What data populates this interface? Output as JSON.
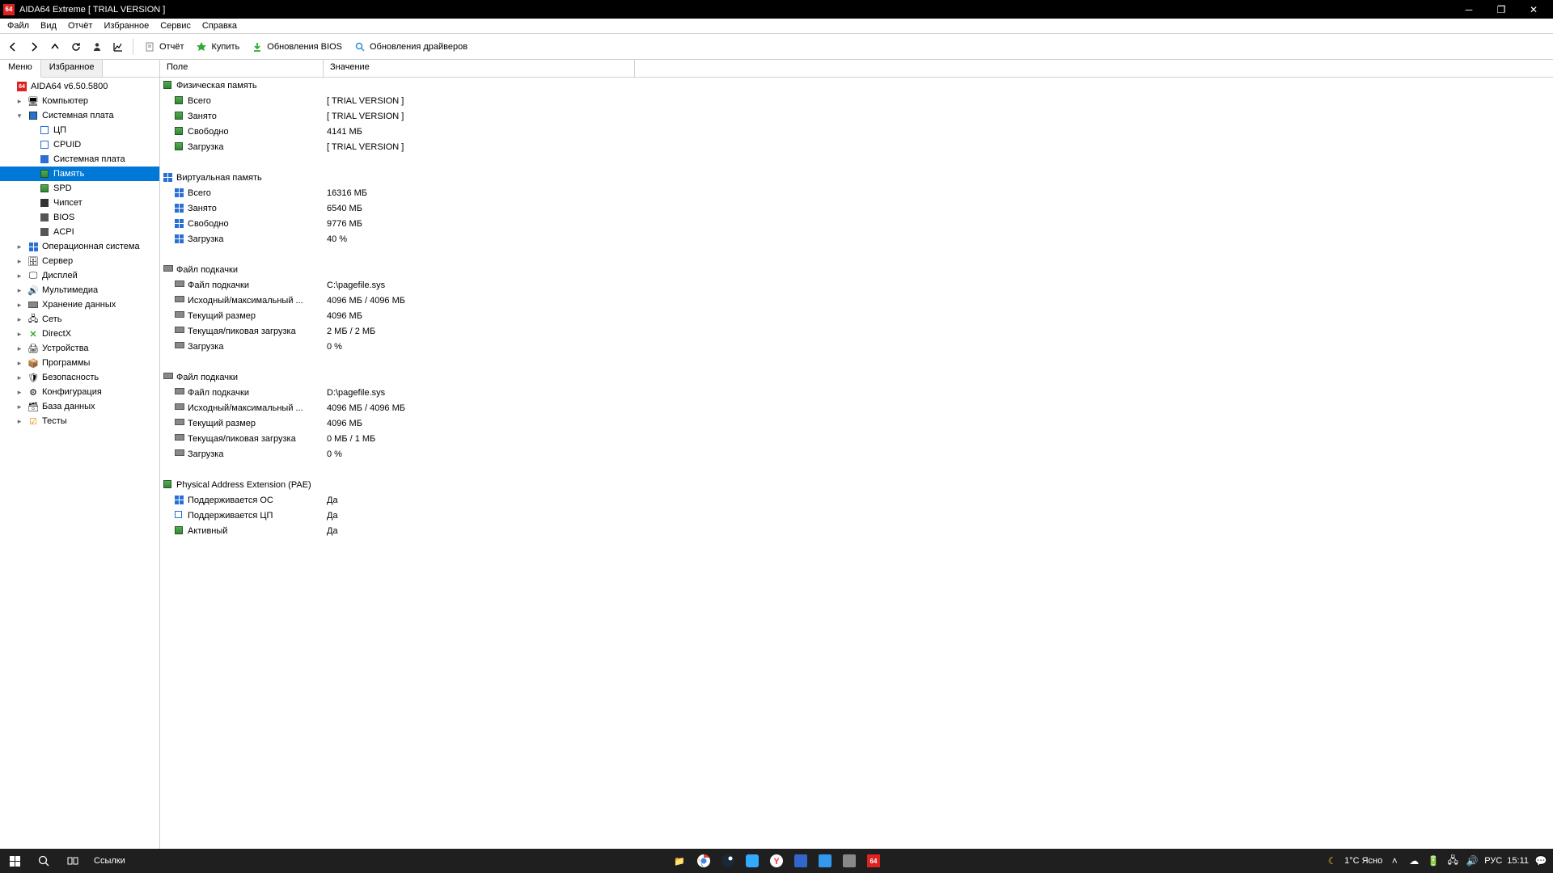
{
  "title": "AIDA64 Extreme  [ TRIAL VERSION ]",
  "menu": [
    "Файл",
    "Вид",
    "Отчёт",
    "Избранное",
    "Сервис",
    "Справка"
  ],
  "toolbar": {
    "report": "Отчёт",
    "buy": "Купить",
    "bios": "Обновления BIOS",
    "drivers": "Обновления драйверов"
  },
  "tabs": {
    "menu": "Меню",
    "fav": "Избранное"
  },
  "tree": {
    "root": "AIDA64 v6.50.5800",
    "computer": "Компьютер",
    "motherboard": "Системная плата",
    "mb_children": [
      "ЦП",
      "CPUID",
      "Системная плата",
      "Память",
      "SPD",
      "Чипсет",
      "BIOS",
      "ACPI"
    ],
    "os": "Операционная система",
    "server": "Сервер",
    "display": "Дисплей",
    "multimedia": "Мультимедиа",
    "storage": "Хранение данных",
    "network": "Сеть",
    "directx": "DirectX",
    "devices": "Устройства",
    "programs": "Программы",
    "security": "Безопасность",
    "config": "Конфигурация",
    "database": "База данных",
    "tests": "Тесты"
  },
  "columns": {
    "field": "Поле",
    "value": "Значение"
  },
  "groups": [
    {
      "title": "Физическая память",
      "icon": "chip-green",
      "rows": [
        {
          "icon": "chip-green",
          "f": "Всего",
          "v": "[ TRIAL VERSION ]"
        },
        {
          "icon": "chip-green",
          "f": "Занято",
          "v": "[ TRIAL VERSION ]"
        },
        {
          "icon": "chip-green",
          "f": "Свободно",
          "v": "4141 МБ"
        },
        {
          "icon": "chip-green",
          "f": "Загрузка",
          "v": "[ TRIAL VERSION ]"
        }
      ]
    },
    {
      "title": "Виртуальная память",
      "icon": "win4",
      "rows": [
        {
          "icon": "win4",
          "f": "Всего",
          "v": "16316 МБ"
        },
        {
          "icon": "win4",
          "f": "Занято",
          "v": "6540 МБ"
        },
        {
          "icon": "win4",
          "f": "Свободно",
          "v": "9776 МБ"
        },
        {
          "icon": "win4",
          "f": "Загрузка",
          "v": "40 %"
        }
      ]
    },
    {
      "title": "Файл подкачки",
      "icon": "hdd",
      "rows": [
        {
          "icon": "hdd",
          "f": "Файл подкачки",
          "v": "C:\\pagefile.sys"
        },
        {
          "icon": "hdd",
          "f": "Исходный/максимальный ...",
          "v": "4096 МБ / 4096 МБ"
        },
        {
          "icon": "hdd",
          "f": "Текущий размер",
          "v": "4096 МБ"
        },
        {
          "icon": "hdd",
          "f": "Текущая/пиковая загрузка",
          "v": "2 МБ / 2 МБ"
        },
        {
          "icon": "hdd",
          "f": "Загрузка",
          "v": "0 %"
        }
      ]
    },
    {
      "title": "Файл подкачки",
      "icon": "hdd",
      "rows": [
        {
          "icon": "hdd",
          "f": "Файл подкачки",
          "v": "D:\\pagefile.sys"
        },
        {
          "icon": "hdd",
          "f": "Исходный/максимальный ...",
          "v": "4096 МБ / 4096 МБ"
        },
        {
          "icon": "hdd",
          "f": "Текущий размер",
          "v": "4096 МБ"
        },
        {
          "icon": "hdd",
          "f": "Текущая/пиковая загрузка",
          "v": "0 МБ / 1 МБ"
        },
        {
          "icon": "hdd",
          "f": "Загрузка",
          "v": "0 %"
        }
      ]
    },
    {
      "title": "Physical Address Extension (PAE)",
      "icon": "chip-green",
      "rows": [
        {
          "icon": "win4",
          "f": "Поддерживается ОС",
          "v": "Да"
        },
        {
          "icon": "sq-outline",
          "f": "Поддерживается ЦП",
          "v": "Да"
        },
        {
          "icon": "chip-green",
          "f": "Активный",
          "v": "Да"
        }
      ]
    }
  ],
  "taskbar": {
    "links": "Ссылки",
    "weather": "1°C  Ясно",
    "lang": "РУС",
    "time": "15:11"
  }
}
